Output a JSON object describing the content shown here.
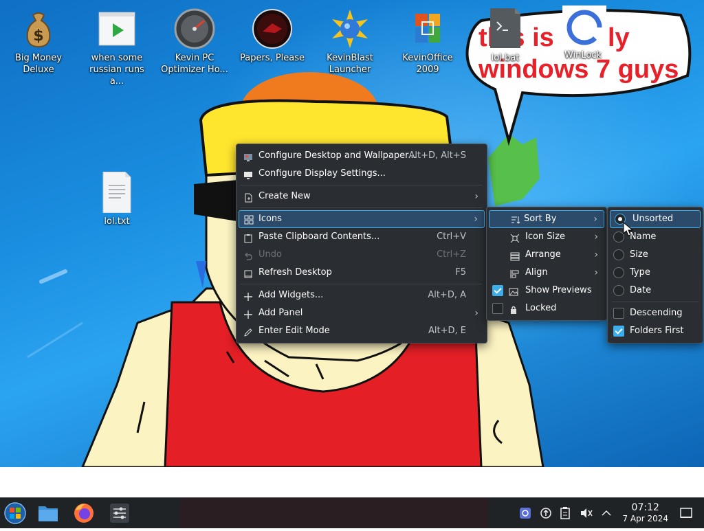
{
  "desktop_icons": [
    {
      "label": "Big Money Deluxe",
      "icon": "money-bag-icon"
    },
    {
      "label": "when some russian runs a...",
      "icon": "video-file-icon"
    },
    {
      "label": "Kevin PC Optimizer Ho...",
      "icon": "gauge-icon"
    },
    {
      "label": "Papers, Please",
      "icon": "papers-please-icon"
    },
    {
      "label": "KevinBlast Launcher",
      "icon": "kevinblast-icon"
    },
    {
      "label": "KevinOffice 2009",
      "icon": "office-icon"
    },
    {
      "label": "lol.bat",
      "icon": "terminal-file-icon"
    },
    {
      "label": "WinLock",
      "icon": "winlock-icon"
    },
    {
      "label": "lol.txt",
      "icon": "text-file-icon"
    }
  ],
  "speech_bubble": {
    "line1": "this is really",
    "line2": "windows 7 guys"
  },
  "context_menu": {
    "items": [
      {
        "label": "Configure Desktop and Wallpaper...",
        "shortcut": "Alt+D, Alt+S",
        "icon": "wallpaper-icon"
      },
      {
        "label": "Configure Display Settings...",
        "shortcut": "",
        "icon": "display-icon"
      },
      {
        "label": "Create New",
        "shortcut": "",
        "icon": "new-file-icon"
      },
      {
        "label": "Icons",
        "shortcut": "",
        "icon": "grid-icon"
      },
      {
        "label": "Paste Clipboard Contents...",
        "shortcut": "Ctrl+V",
        "icon": "paste-icon"
      },
      {
        "label": "Undo",
        "shortcut": "Ctrl+Z",
        "icon": "undo-icon"
      },
      {
        "label": "Refresh Desktop",
        "shortcut": "F5",
        "icon": "refresh-icon"
      },
      {
        "label": "Add Widgets...",
        "shortcut": "Alt+D, A",
        "icon": "plus-icon"
      },
      {
        "label": "Add Panel",
        "shortcut": "",
        "icon": "plus-icon"
      },
      {
        "label": "Enter Edit Mode",
        "shortcut": "Alt+D, E",
        "icon": "pencil-icon"
      }
    ]
  },
  "icons_submenu": {
    "items": [
      {
        "label": "Sort By"
      },
      {
        "label": "Icon Size"
      },
      {
        "label": "Arrange"
      },
      {
        "label": "Align"
      },
      {
        "label": "Show Previews",
        "checked": true
      },
      {
        "label": "Locked",
        "checked": false
      }
    ]
  },
  "sort_submenu": {
    "options": [
      {
        "label": "Unsorted",
        "selected": true
      },
      {
        "label": "Name",
        "selected": false
      },
      {
        "label": "Size",
        "selected": false
      },
      {
        "label": "Type",
        "selected": false
      },
      {
        "label": "Date",
        "selected": false
      }
    ],
    "descending": {
      "label": "Descending",
      "checked": false
    },
    "folders_first": {
      "label": "Folders First",
      "checked": true
    }
  },
  "taskbar": {
    "apps": [
      "start-menu-icon",
      "file-manager-icon",
      "firefox-icon",
      "system-settings-icon"
    ],
    "tray": [
      "kde-connect-icon",
      "updates-icon",
      "clipboard-icon",
      "volume-muted-icon",
      "tray-expand-icon"
    ],
    "clock": {
      "time": "07:12",
      "date": "7 Apr 2024"
    }
  },
  "colors": {
    "accent": "#3daee9",
    "menu_bg": "#2a2e32",
    "taskbar_bg": "#202326",
    "bubble_text": "#e8202a"
  }
}
